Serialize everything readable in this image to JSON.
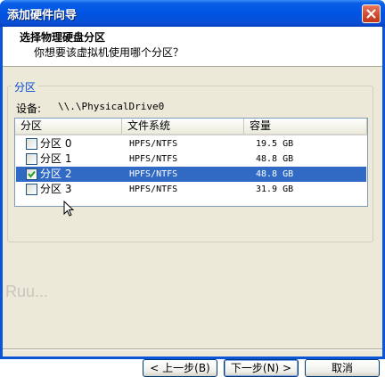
{
  "window": {
    "title": "添加硬件向导"
  },
  "header": {
    "title": "选择物理硬盘分区",
    "subtitle": "你想要该虚拟机使用哪个分区？"
  },
  "group": {
    "legend": "分区",
    "device_label": "设备:",
    "device_value": "\\\\.\\PhysicalDrive0"
  },
  "table": {
    "columns": [
      "分区",
      "文件系统",
      "容量"
    ],
    "rows": [
      {
        "name": "分区 0",
        "fs": "HPFS/NTFS",
        "capacity": "19.5 GB",
        "checked": false,
        "selected": false
      },
      {
        "name": "分区 1",
        "fs": "HPFS/NTFS",
        "capacity": "48.8 GB",
        "checked": false,
        "selected": false
      },
      {
        "name": "分区 2",
        "fs": "HPFS/NTFS",
        "capacity": "48.8 GB",
        "checked": true,
        "selected": true
      },
      {
        "name": "分区 3",
        "fs": "HPFS/NTFS",
        "capacity": "31.9 GB",
        "checked": false,
        "selected": false
      }
    ]
  },
  "watermark": "Ruu...",
  "buttons": {
    "back": "< 上一步(B)",
    "next": "下一步(N) >",
    "cancel": "取消"
  },
  "colors": {
    "titlebar": "#0054e3",
    "selection": "#316ac5",
    "group_legend": "#0046d5"
  }
}
